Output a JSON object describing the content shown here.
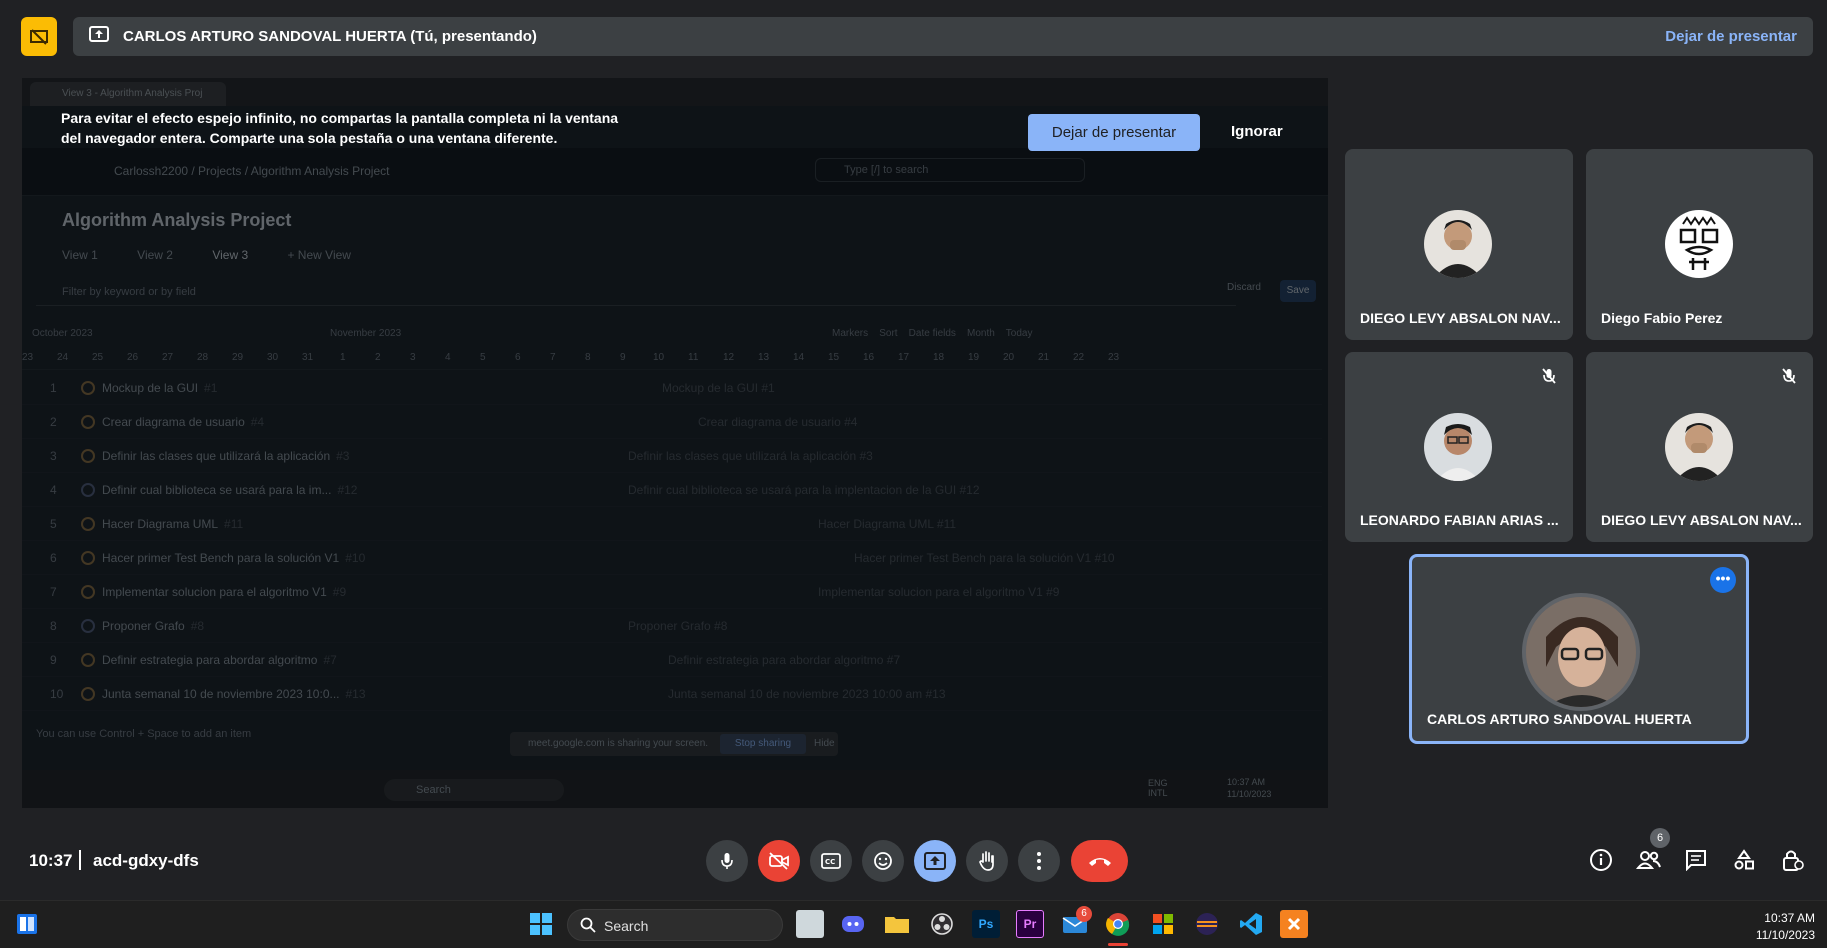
{
  "banner": {
    "title": "CARLOS ARTURO SANDOVAL HUERTA (Tú, presentando)",
    "stop_label": "Dejar de presentar"
  },
  "warning": {
    "line1": "Para evitar el efecto espejo infinito, no compartas la pantalla completa ni la ventana",
    "line2": "del navegador entera. Comparte una sola pestaña o una ventana diferente.",
    "stop_label": "Dejar de presentar",
    "ignore_label": "Ignorar"
  },
  "shared_screen": {
    "tab_title": "View 3 - Algorithm Analysis Proj",
    "breadcrumb": "Carlossh2200  /  Projects  /  Algorithm Analysis Project",
    "search_placeholder": "Type [/] to search",
    "project_title": "Algorithm Analysis Project",
    "views": [
      "View 1",
      "View 2",
      "View 3",
      "+ New View"
    ],
    "filter_placeholder": "Filter by keyword or by field",
    "discard_label": "Discard",
    "save_label": "Save",
    "month1": "October 2023",
    "month2": "November 2023",
    "toolbar": "Markers    Sort    Date fields    Month    Today",
    "rows": [
      {
        "num": "1",
        "title": "Mockup de la GUI",
        "id": "#1",
        "bar": "Mockup de la GUI #1"
      },
      {
        "num": "2",
        "title": "Crear diagrama de usuario",
        "id": "#4",
        "bar": "Crear diagrama de usuario #4"
      },
      {
        "num": "3",
        "title": "Definir las clases que utilizará la aplicación",
        "id": "#3",
        "bar": "Definir las clases que utilizará la aplicación #3"
      },
      {
        "num": "4",
        "title": "Definir cual biblioteca se usará para la im...",
        "id": "#12",
        "bar": "Definir cual biblioteca se usará para la implentacion de la GUI #12"
      },
      {
        "num": "5",
        "title": "Hacer Diagrama UML",
        "id": "#11",
        "bar": "Hacer Diagrama UML #11"
      },
      {
        "num": "6",
        "title": "Hacer primer Test Bench para la solución V1",
        "id": "#10",
        "bar": "Hacer primer Test Bench para la solución V1 #10"
      },
      {
        "num": "7",
        "title": "Implementar solucion para el algoritmo V1",
        "id": "#9",
        "bar": "Implementar solucion para el algoritmo V1 #9"
      },
      {
        "num": "8",
        "title": "Proponer Grafo",
        "id": "#8",
        "bar": "Proponer Grafo #8"
      },
      {
        "num": "9",
        "title": "Definir estrategia para abordar algoritmo",
        "id": "#7",
        "bar": "Definir estrategia para abordar algoritmo #7"
      },
      {
        "num": "10",
        "title": "Junta semanal 10 de noviembre 2023 10:0...",
        "id": "#13",
        "bar": "Junta semanal 10 de noviembre 2023 10:00 am #13"
      }
    ],
    "add_item": "You can use  Control + Space  to add an item",
    "sharing_text": "meet.google.com is sharing your screen.",
    "stop_sharing": "Stop sharing",
    "hide": "Hide",
    "taskbar_search": "Search",
    "lang": "ENG INTL",
    "time": "10:37 AM",
    "date": "11/10/2023"
  },
  "participants": [
    {
      "name": "DIEGO LEVY ABSALON NAV...",
      "muted": false
    },
    {
      "name": "Diego Fabio Perez",
      "muted": false
    },
    {
      "name": "LEONARDO FABIAN ARIAS ...",
      "muted": true
    },
    {
      "name": "DIEGO LEVY ABSALON NAV...",
      "muted": true
    },
    {
      "name": "CARLOS ARTURO SANDOVAL HUERTA",
      "muted": false
    }
  ],
  "meeting": {
    "time": "10:37",
    "code": "acd-gdxy-dfs",
    "people_count": "6"
  },
  "taskbar": {
    "search": "Search",
    "mail_badge": "6",
    "time": "10:37 AM",
    "date": "11/10/2023"
  },
  "colors": {
    "accent": "#8ab4f8",
    "end_call": "#ea4335",
    "present_badge": "#fbbc04",
    "tile_bg": "#3c4043"
  }
}
